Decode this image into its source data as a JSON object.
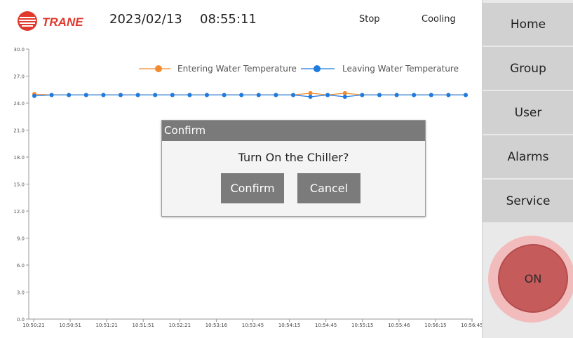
{
  "header": {
    "brand": "TRANE",
    "date": "2023/02/13",
    "time": "08:55:11",
    "unit_status": "Stop",
    "operating_mode": "Cooling"
  },
  "sidebar": {
    "items": [
      {
        "label": "Home"
      },
      {
        "label": "Group"
      },
      {
        "label": "User"
      },
      {
        "label": "Alarms"
      },
      {
        "label": "Service"
      }
    ],
    "power_button": "ON"
  },
  "dialog": {
    "title": "Confirm",
    "message": "Turn On the Chiller?",
    "confirm_label": "Confirm",
    "cancel_label": "Cancel"
  },
  "colors": {
    "entering": "#f28b2e",
    "leaving": "#1e7be0",
    "brand_red": "#e03a2f"
  },
  "chart_data": {
    "type": "line",
    "title": "",
    "xlabel": "",
    "ylabel": "",
    "ylim": [
      0,
      30
    ],
    "yticks": [
      "0.0",
      "3.0",
      "6.0",
      "9.0",
      "12.0",
      "15.0",
      "18.0",
      "21.0",
      "24.0",
      "27.0",
      "30.0"
    ],
    "x": [
      "10:50:21",
      "10:50:51",
      "10:51:21",
      "10:51:51",
      "10:52:21",
      "10:53:16",
      "10:53:45",
      "10:54:15",
      "10:54:45",
      "10:55:15",
      "10:55:46",
      "10:56:15",
      "10:56:45"
    ],
    "legend_position": "top-right",
    "series": [
      {
        "name": "Entering Water Temperature",
        "color": "#f28b2e",
        "values": [
          25.0,
          24.9,
          24.9,
          24.9,
          24.9,
          24.9,
          24.9,
          24.9,
          24.9,
          24.9,
          24.9,
          24.9,
          24.9,
          24.9,
          24.9,
          24.9,
          25.1,
          24.9,
          25.1,
          24.9,
          24.9,
          24.9,
          24.9,
          24.9,
          24.9,
          24.9
        ]
      },
      {
        "name": "Leaving Water Temperature",
        "color": "#1e7be0",
        "values": [
          24.8,
          24.9,
          24.9,
          24.9,
          24.9,
          24.9,
          24.9,
          24.9,
          24.9,
          24.9,
          24.9,
          24.9,
          24.9,
          24.9,
          24.9,
          24.9,
          24.7,
          24.9,
          24.7,
          24.9,
          24.9,
          24.9,
          24.9,
          24.9,
          24.9,
          24.9
        ]
      }
    ]
  }
}
